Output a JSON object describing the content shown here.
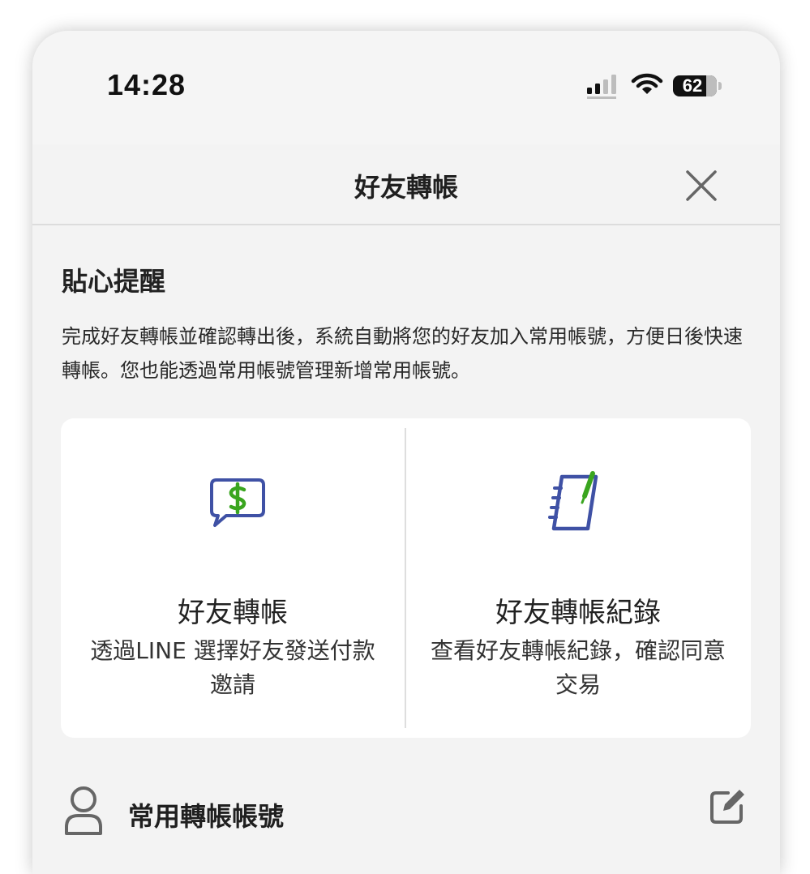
{
  "status_bar": {
    "time": "14:28",
    "battery_level": "62"
  },
  "nav": {
    "title": "好友轉帳",
    "close_icon": "close-icon"
  },
  "reminder": {
    "title": "貼心提醒",
    "text": "完成好友轉帳並確認轉出後，系統自動將您的好友加入常用帳號，方便日後快速轉帳。您也能透過常用帳號管理新增常用帳號。"
  },
  "cards": [
    {
      "icon": "money-message-icon",
      "title": "好友轉帳",
      "description": "透過LINE 選擇好友發送付款邀請"
    },
    {
      "icon": "notebook-pen-icon",
      "title": "好友轉帳紀錄",
      "description": "查看好友轉帳紀錄，確認同意交易"
    }
  ],
  "favorites": {
    "label": "常用轉帳帳號",
    "icon": "person-icon",
    "edit_icon": "edit-icon"
  },
  "colors": {
    "icon_blue": "#3f51a5",
    "icon_green": "#3aa51f",
    "text_dark": "#222222",
    "background": "#f3f3f3"
  }
}
